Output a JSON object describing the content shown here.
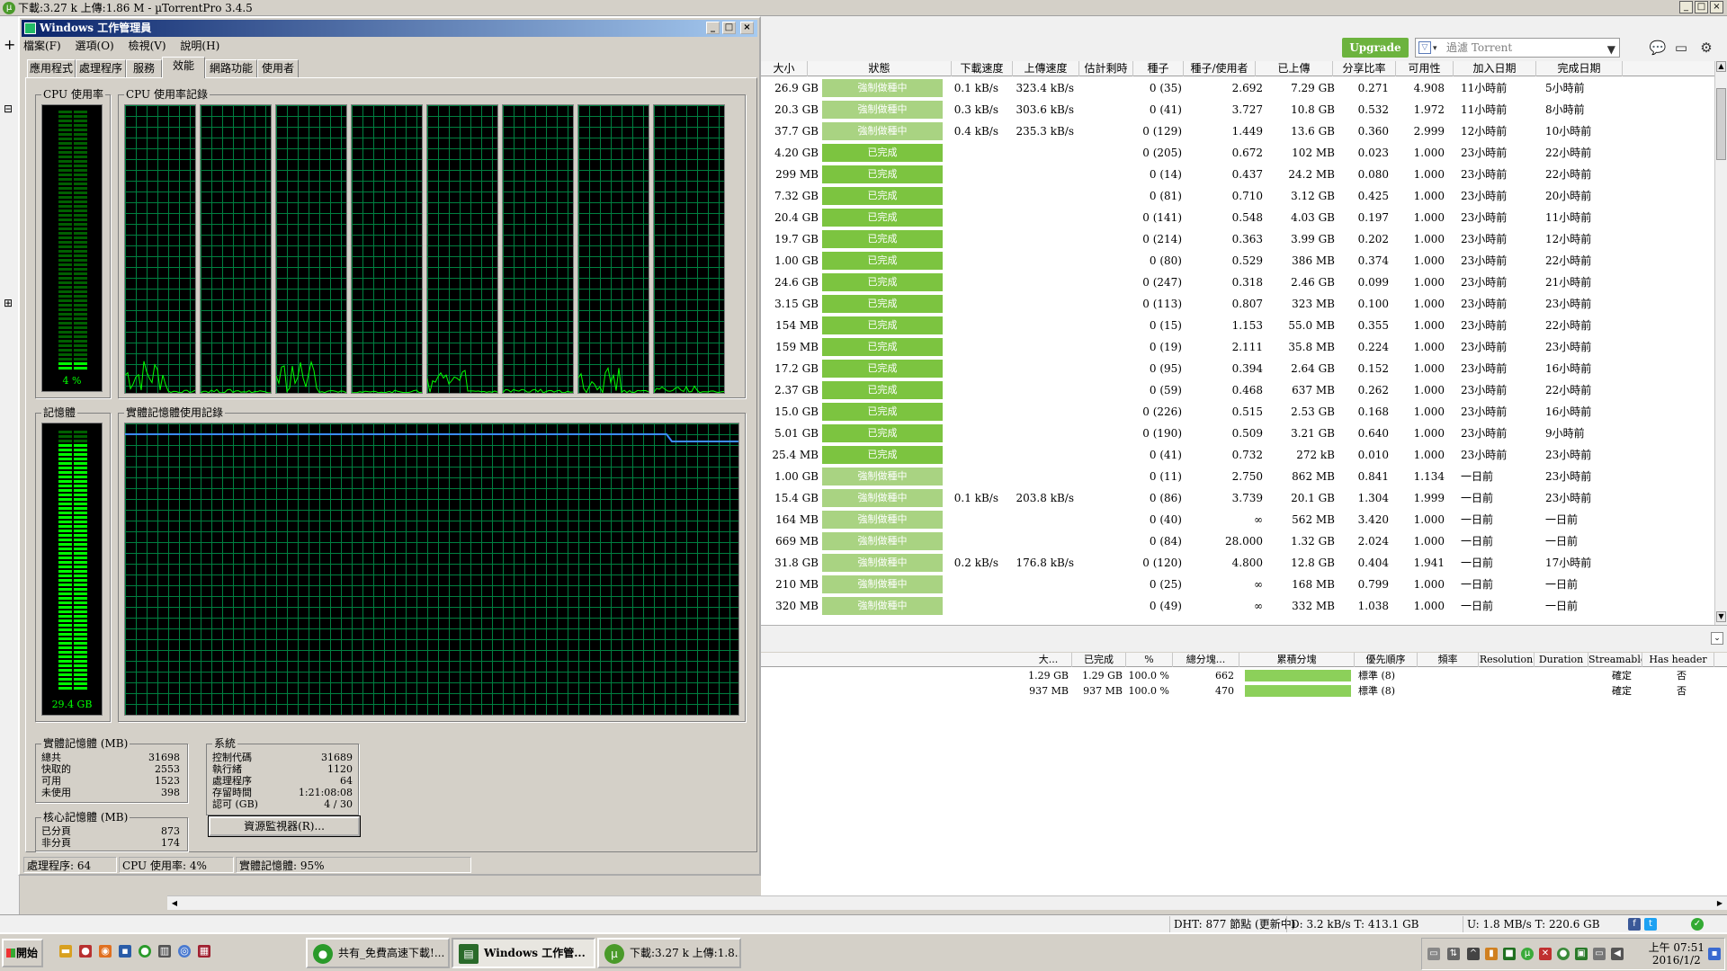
{
  "utorrent": {
    "title": "下載:3.27 k 上傳:1.86 M - µTorrentPro 3.4.5",
    "upgrade_label": "Upgrade",
    "filter_placeholder": "過濾 Torrent",
    "columns": [
      "大小",
      "狀態",
      "下載速度",
      "上傳速度",
      "估計剩時",
      "種子",
      "種子/使用者",
      "已上傳",
      "分享比率",
      "可用性",
      "加入日期",
      "完成日期"
    ],
    "rows": [
      [
        "26.9 GB",
        "強制做種中",
        "0.1 kB/s",
        "323.4 kB/s",
        "",
        "0 (35)",
        "2.692",
        "7.29 GB",
        "0.271",
        "4.908",
        "11小時前",
        "5小時前"
      ],
      [
        "20.3 GB",
        "強制做種中",
        "0.3 kB/s",
        "303.6 kB/s",
        "",
        "0 (41)",
        "3.727",
        "10.8 GB",
        "0.532",
        "1.972",
        "11小時前",
        "8小時前"
      ],
      [
        "37.7 GB",
        "強制做種中",
        "0.4 kB/s",
        "235.3 kB/s",
        "",
        "0 (129)",
        "1.449",
        "13.6 GB",
        "0.360",
        "2.999",
        "12小時前",
        "10小時前"
      ],
      [
        "4.20 GB",
        "已完成",
        "",
        "",
        "",
        "0 (205)",
        "0.672",
        "102 MB",
        "0.023",
        "1.000",
        "23小時前",
        "22小時前"
      ],
      [
        "299 MB",
        "已完成",
        "",
        "",
        "",
        "0 (14)",
        "0.437",
        "24.2 MB",
        "0.080",
        "1.000",
        "23小時前",
        "22小時前"
      ],
      [
        "7.32 GB",
        "已完成",
        "",
        "",
        "",
        "0 (81)",
        "0.710",
        "3.12 GB",
        "0.425",
        "1.000",
        "23小時前",
        "20小時前"
      ],
      [
        "20.4 GB",
        "已完成",
        "",
        "",
        "",
        "0 (141)",
        "0.548",
        "4.03 GB",
        "0.197",
        "1.000",
        "23小時前",
        "11小時前"
      ],
      [
        "19.7 GB",
        "已完成",
        "",
        "",
        "",
        "0 (214)",
        "0.363",
        "3.99 GB",
        "0.202",
        "1.000",
        "23小時前",
        "12小時前"
      ],
      [
        "1.00 GB",
        "已完成",
        "",
        "",
        "",
        "0 (80)",
        "0.529",
        "386 MB",
        "0.374",
        "1.000",
        "23小時前",
        "22小時前"
      ],
      [
        "24.6 GB",
        "已完成",
        "",
        "",
        "",
        "0 (247)",
        "0.318",
        "2.46 GB",
        "0.099",
        "1.000",
        "23小時前",
        "21小時前"
      ],
      [
        "3.15 GB",
        "已完成",
        "",
        "",
        "",
        "0 (113)",
        "0.807",
        "323 MB",
        "0.100",
        "1.000",
        "23小時前",
        "23小時前"
      ],
      [
        "154 MB",
        "已完成",
        "",
        "",
        "",
        "0 (15)",
        "1.153",
        "55.0 MB",
        "0.355",
        "1.000",
        "23小時前",
        "22小時前"
      ],
      [
        "159 MB",
        "已完成",
        "",
        "",
        "",
        "0 (19)",
        "2.111",
        "35.8 MB",
        "0.224",
        "1.000",
        "23小時前",
        "23小時前"
      ],
      [
        "17.2 GB",
        "已完成",
        "",
        "",
        "",
        "0 (95)",
        "0.394",
        "2.64 GB",
        "0.152",
        "1.000",
        "23小時前",
        "16小時前"
      ],
      [
        "2.37 GB",
        "已完成",
        "",
        "",
        "",
        "0 (59)",
        "0.468",
        "637 MB",
        "0.262",
        "1.000",
        "23小時前",
        "22小時前"
      ],
      [
        "15.0 GB",
        "已完成",
        "",
        "",
        "",
        "0 (226)",
        "0.515",
        "2.53 GB",
        "0.168",
        "1.000",
        "23小時前",
        "16小時前"
      ],
      [
        "5.01 GB",
        "已完成",
        "",
        "",
        "",
        "0 (190)",
        "0.509",
        "3.21 GB",
        "0.640",
        "1.000",
        "23小時前",
        "9小時前"
      ],
      [
        "25.4 MB",
        "已完成",
        "",
        "",
        "",
        "0 (41)",
        "0.732",
        "272 kB",
        "0.010",
        "1.000",
        "23小時前",
        "23小時前"
      ],
      [
        "1.00 GB",
        "強制做種中",
        "",
        "",
        "",
        "0 (11)",
        "2.750",
        "862 MB",
        "0.841",
        "1.134",
        "一日前",
        "23小時前"
      ],
      [
        "15.4 GB",
        "強制做種中",
        "0.1 kB/s",
        "203.8 kB/s",
        "",
        "0 (86)",
        "3.739",
        "20.1 GB",
        "1.304",
        "1.999",
        "一日前",
        "23小時前"
      ],
      [
        "164 MB",
        "強制做種中",
        "",
        "",
        "",
        "0 (40)",
        "∞",
        "562 MB",
        "3.420",
        "1.000",
        "一日前",
        "一日前"
      ],
      [
        "669 MB",
        "強制做種中",
        "",
        "",
        "",
        "0 (84)",
        "28.000",
        "1.32 GB",
        "2.024",
        "1.000",
        "一日前",
        "一日前"
      ],
      [
        "31.8 GB",
        "強制做種中",
        "0.2 kB/s",
        "176.8 kB/s",
        "",
        "0 (120)",
        "4.800",
        "12.8 GB",
        "0.404",
        "1.941",
        "一日前",
        "17小時前"
      ],
      [
        "210 MB",
        "強制做種中",
        "",
        "",
        "",
        "0 (25)",
        "∞",
        "168 MB",
        "0.799",
        "1.000",
        "一日前",
        "一日前"
      ],
      [
        "320 MB",
        "強制做種中",
        "",
        "",
        "",
        "0 (49)",
        "∞",
        "332 MB",
        "1.038",
        "1.000",
        "一日前",
        "一日前"
      ]
    ],
    "file_columns": [
      "大...",
      "已完成",
      "%",
      "總分塊...",
      "累積分塊",
      "優先順序",
      "頻率",
      "Resolution",
      "Duration",
      "Streamable",
      "Has header"
    ],
    "files": [
      [
        "1.29 GB",
        "1.29 GB",
        "100.0 %",
        "662",
        "",
        "標準 (8)",
        "",
        "",
        "",
        "確定",
        "否"
      ],
      [
        "937 MB",
        "937 MB",
        "100.0 %",
        "470",
        "",
        "標準 (8)",
        "",
        "",
        "",
        "確定",
        "否"
      ]
    ],
    "status": {
      "dht": "DHT: 877 節點 (更新中)",
      "down": "D: 3.2 kB/s T: 413.1 GB",
      "up": "U: 1.8 MB/s T: 220.6 GB"
    },
    "colors": {
      "done": "#7cc440",
      "force": "#a9d382",
      "upgrade": "#6cb33e"
    }
  },
  "taskmgr": {
    "title": "Windows 工作管理員",
    "menu": [
      "檔案(F)",
      "選項(O)",
      "檢視(V)",
      "說明(H)"
    ],
    "tabs": [
      "應用程式",
      "處理程序",
      "服務",
      "效能",
      "網路功能",
      "使用者"
    ],
    "cpu_usage_label": "CPU 使用率",
    "cpu_usage_value": "4 %",
    "cpu_usage_percent": 4,
    "cpu_history_label": "CPU 使用率記錄",
    "mem_label": "記憶體",
    "mem_value": "29.4 GB",
    "mem_percent": 95,
    "mem_history_label": "實體記憶體使用記錄",
    "physical": {
      "title": "實體記憶體 (MB)",
      "rows": [
        [
          "總共",
          "31698"
        ],
        [
          "快取的",
          "2553"
        ],
        [
          "可用",
          "1523"
        ],
        [
          "未使用",
          "398"
        ]
      ]
    },
    "kernel": {
      "title": "核心記憶體 (MB)",
      "rows": [
        [
          "已分頁",
          "873"
        ],
        [
          "非分頁",
          "174"
        ]
      ]
    },
    "system": {
      "title": "系統",
      "rows": [
        [
          "控制代碼",
          "31689"
        ],
        [
          "執行緒",
          "1120"
        ],
        [
          "處理程序",
          "64"
        ],
        [
          "存留時間",
          "1:21:08:08"
        ],
        [
          "認可 (GB)",
          "4 / 30"
        ]
      ]
    },
    "resmon_button": "資源監視器(R)...",
    "status": [
      "處理程序: 64",
      "CPU 使用率: 4%",
      "實體記憶體: 95%"
    ]
  },
  "taskbar": {
    "start": "開始",
    "buttons": [
      "共有_免費高速下載!...",
      "Windows 工作管...",
      "下載:3.27 k 上傳:1.8..."
    ],
    "clock_time": "上午 07:51",
    "clock_date": "2016/1/2"
  }
}
